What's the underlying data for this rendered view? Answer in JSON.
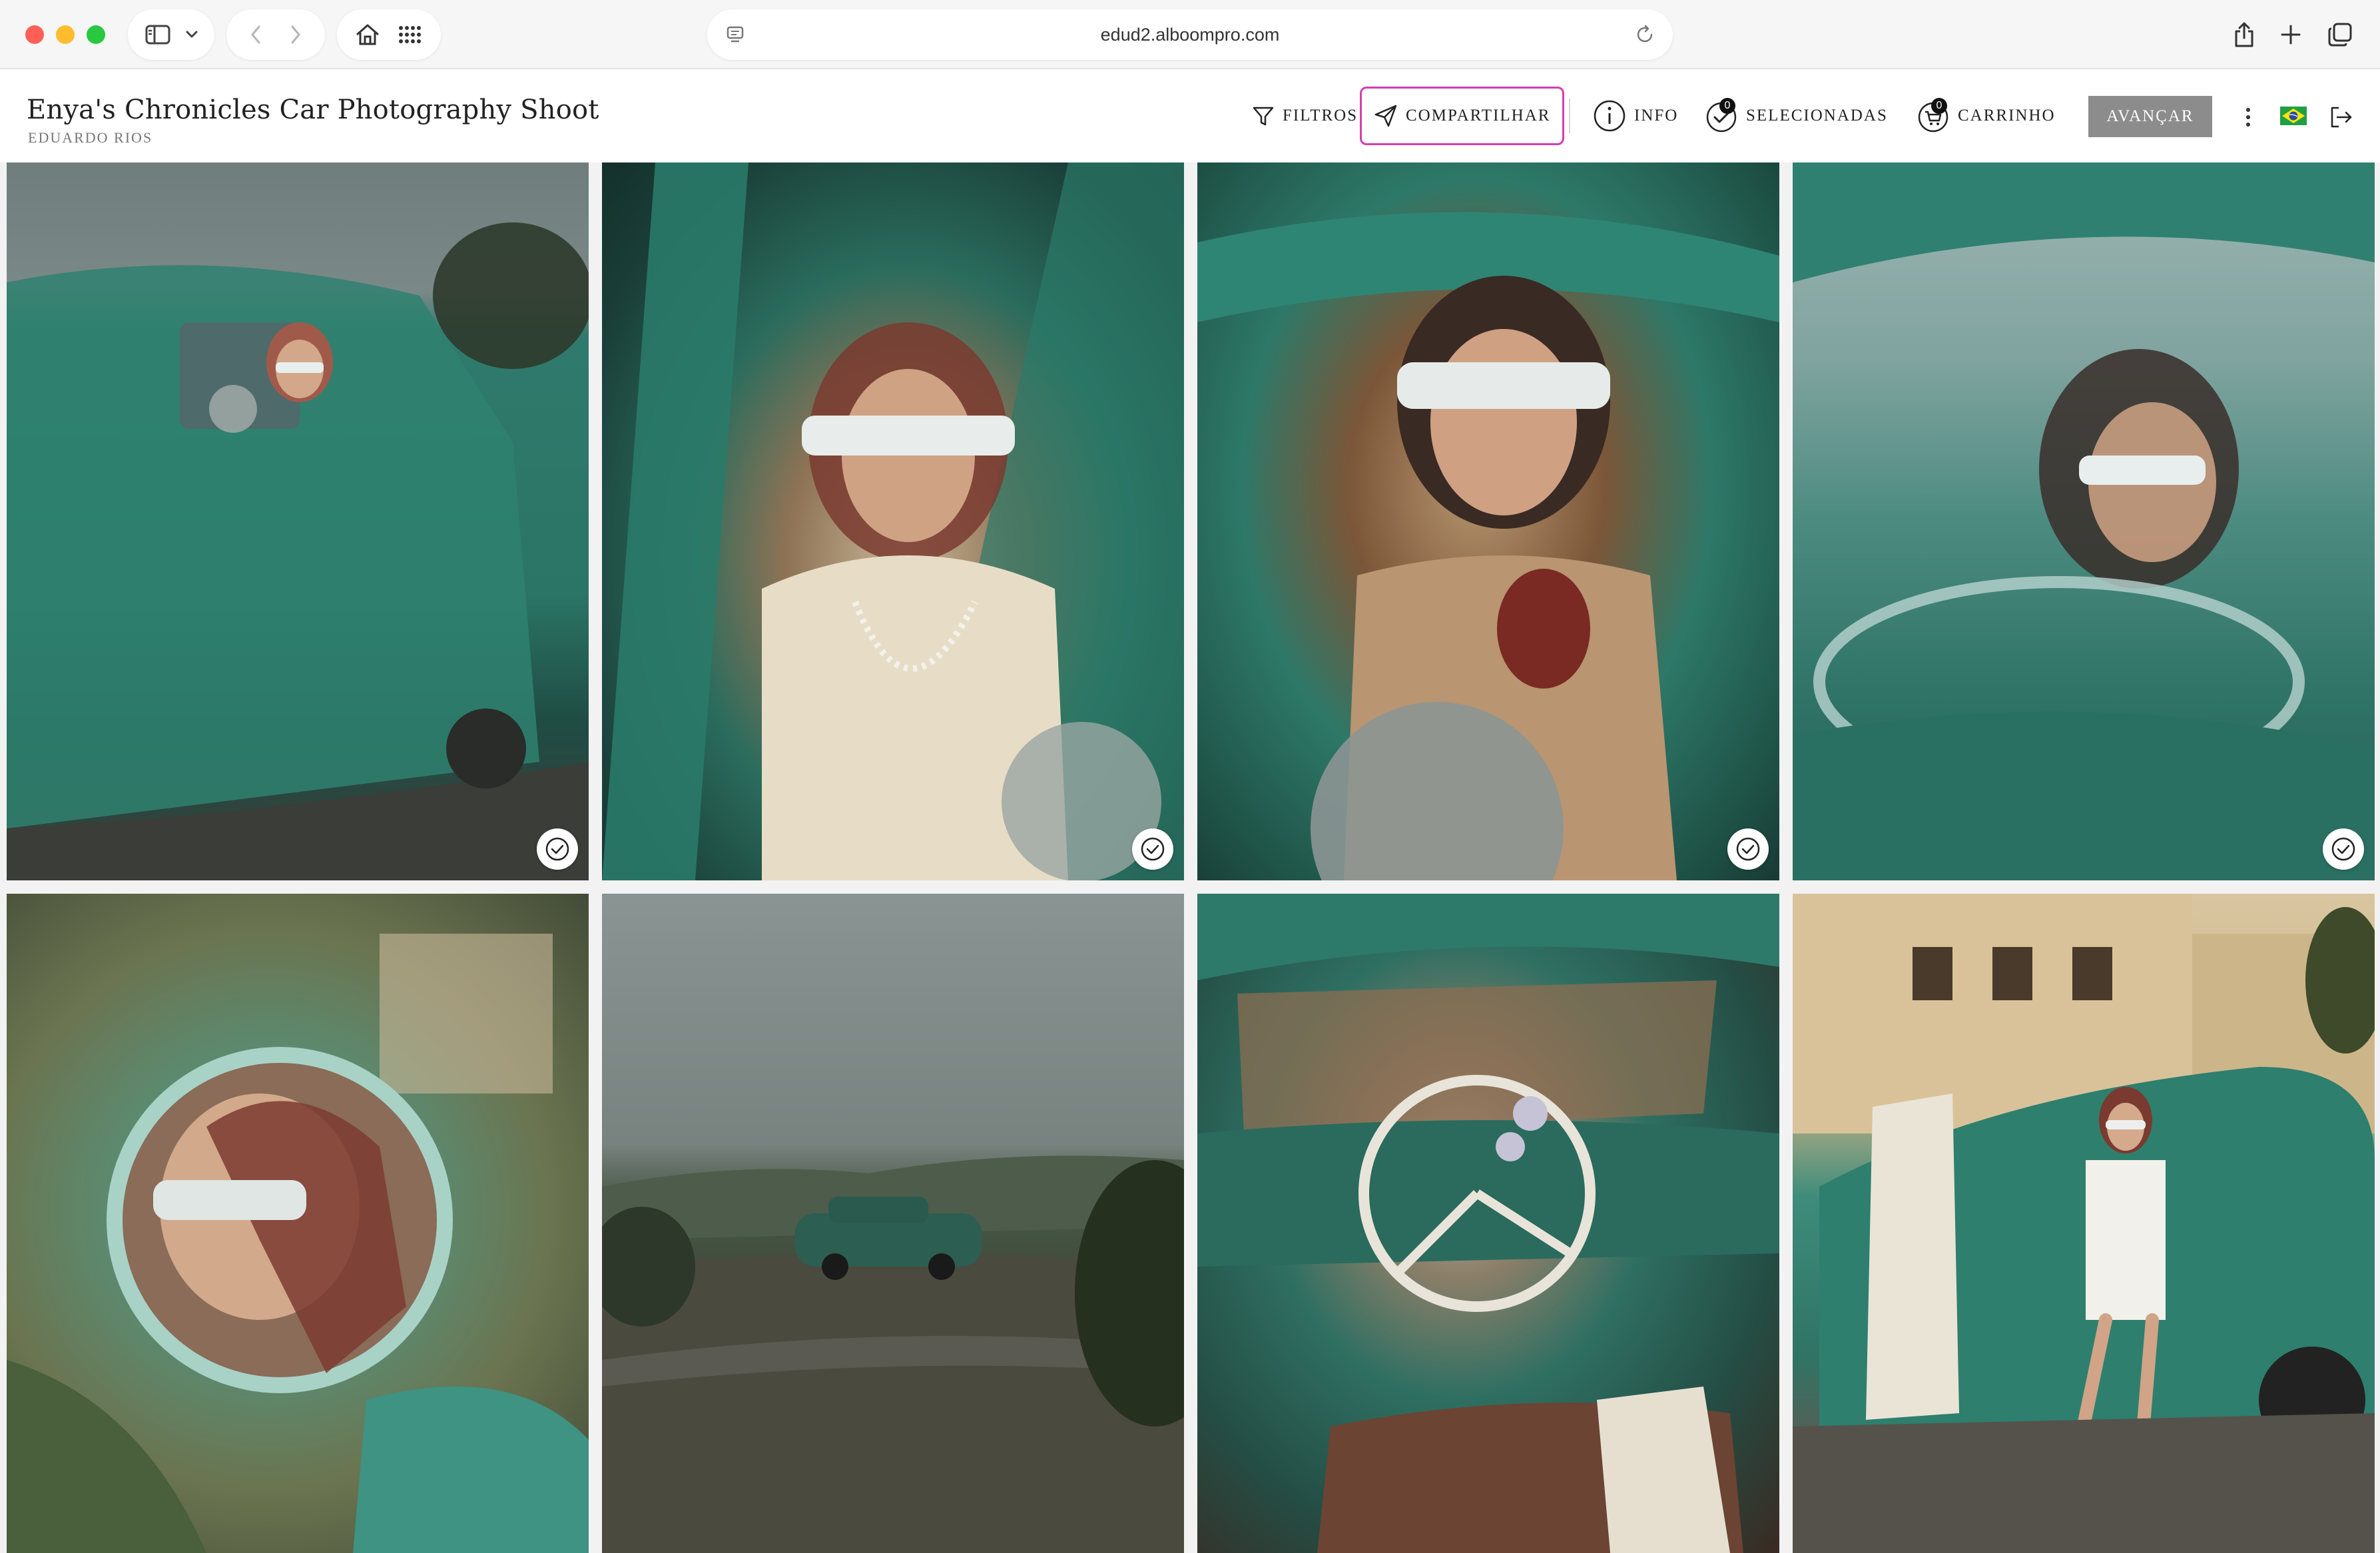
{
  "browser": {
    "url": "edud2.alboompro.com"
  },
  "gallery": {
    "title": "Enya's Chronicles Car Photography Shoot",
    "photographer": "EDUARDO RIOS"
  },
  "toolbar": {
    "filters_label": "FILTROS",
    "share_label": "COMPARTILHAR",
    "info_label": "INFO",
    "selected_label": "SELECIONADAS",
    "selected_count": "0",
    "cart_label": "CARRINHO",
    "cart_count": "0",
    "advance_label": "AVANÇAR",
    "share_border_color": "#d63eb0",
    "advance_bg_color": "#8c8c8c"
  },
  "icons": {
    "chrome": [
      "sidebar-icon",
      "chevron-down-icon",
      "back-icon",
      "forward-icon",
      "home-icon",
      "grid-icon",
      "site-icon",
      "reload-icon",
      "share-icon",
      "plus-icon",
      "tabs-icon"
    ],
    "toolbar": [
      "filter-icon",
      "send-icon",
      "info-icon",
      "check-circle-icon",
      "cart-icon",
      "more-vertical-icon",
      "brazil-flag-icon",
      "logout-icon"
    ]
  },
  "photos": [
    {
      "scene": "Woman in headscarf and white cat-eye sunglasses leaning out of a teal vintage car",
      "selectable": true
    },
    {
      "scene": "Close-up of woman in car window with pearl necklaces and patterned headscarf",
      "selectable": true
    },
    {
      "scene": "Woman applying lipstick inside teal car, wearing red gloves",
      "selectable": true
    },
    {
      "scene": "Woman driving teal car, seen through windshield",
      "selectable": true
    },
    {
      "scene": "Woman reflected in round side mirror of teal car",
      "selectable": false
    },
    {
      "scene": "Teal vintage car on a country road under cloudy sky",
      "selectable": false
    },
    {
      "scene": "Vintage car interior with white steering wheel and fuzzy dice",
      "selectable": false
    },
    {
      "scene": "Woman stepping out of teal car in front of a yellow mansion",
      "selectable": false
    }
  ]
}
